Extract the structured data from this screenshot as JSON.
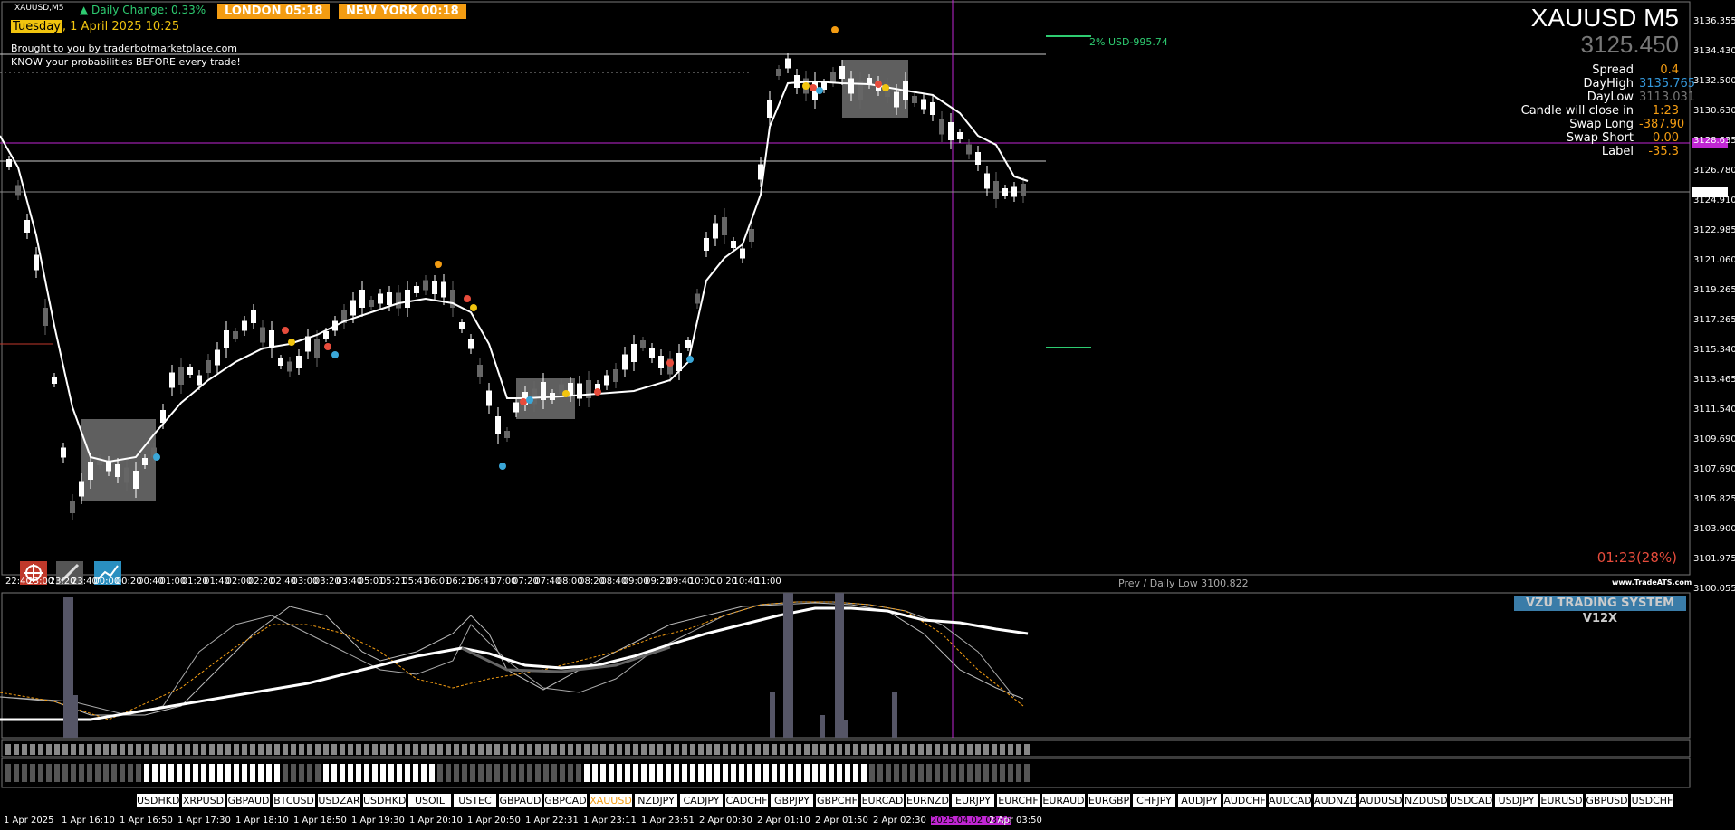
{
  "header": {
    "symbol_tf": "XAUUSD,M5",
    "daily_change": "▲ Daily Change: 0.33%",
    "sessions": [
      {
        "label": "LONDON  05:18"
      },
      {
        "label": "NEW YORK  00:18"
      }
    ],
    "date_day": "Tuesday",
    "date_rest": ", 1 April 2025 10:25",
    "promo1": "Brought to you by traderbotmarketplace.com",
    "promo2": "KNOW your probabilities BEFORE every trade!"
  },
  "panel": {
    "symbol": "XAUUSD M5",
    "price": "3125.450",
    "rows": [
      {
        "label": "Spread",
        "value": "0.4",
        "value_color": "#f39c12"
      },
      {
        "label": "DayHigh",
        "value": "3135.765",
        "value_color": "#3498db"
      },
      {
        "label": "DayLow",
        "value": "3113.031",
        "value_color": "#777777"
      },
      {
        "label": "Candle will close in",
        "value": "1:23",
        "value_color": "#f39c12"
      },
      {
        "label": "Swap Long",
        "value": "-387.90",
        "value_color": "#f39c12"
      },
      {
        "label": "Swap Short",
        "value": "0.00",
        "value_color": "#f39c12"
      },
      {
        "label": "Label",
        "value": "-35.3",
        "value_color": "#f39c12"
      }
    ]
  },
  "risk_label": "2% USD-995.74",
  "timer": "01:23(28%)",
  "prev_low": "Prev / Daily Low 3100.822",
  "brand": "www.TradeATS.com",
  "price_axis": [
    "3136.355",
    "3134.430",
    "3132.500",
    "3130.630",
    "3128.635",
    "3126.780",
    "3124.910",
    "3122.985",
    "3121.060",
    "3119.265",
    "3117.265",
    "3115.340",
    "3113.465",
    "3111.540",
    "3109.690",
    "3107.690",
    "3105.825",
    "3103.900",
    "3101.975",
    "3100.055"
  ],
  "current_price_tag": "3125.450",
  "magenta_tag": "3128.539",
  "time_axis": [
    "22:40",
    "23:00",
    "23:20",
    "23:40",
    "00:00",
    "00:20",
    "00:40",
    "01:00",
    "01:20",
    "01:40",
    "02:00",
    "02:20",
    "02:40",
    "03:00",
    "03:20",
    "03:40",
    "05:01",
    "05:21",
    "05:41",
    "06:01",
    "06:21",
    "06:41",
    "07:00",
    "07:20",
    "07:40",
    "08:00",
    "08:20",
    "08:40",
    "09:00",
    "09:20",
    "09:40",
    "10:00",
    "10:20",
    "10:40",
    "11:00"
  ],
  "indicator_title": "VZU TRADING SYSTEM V12X",
  "indicator_zero": "0",
  "tickers": [
    "USDHKD",
    "XRPUSD",
    "GBPAUD",
    "BTCUSD",
    "USDZAR",
    "USDHKD",
    "USOIL",
    "USTEC",
    "GBPAUD",
    "GBPCAD",
    "XAUUSD",
    "NZDJPY",
    "CADJPY",
    "CADCHF",
    "GBPJPY",
    "GBPCHF",
    "EURCAD",
    "EURNZD",
    "EURJPY",
    "EURCHF",
    "EURAUD",
    "EURGBP",
    "CHFJPY",
    "AUDJPY",
    "AUDCHF",
    "AUDCAD",
    "AUDNZD",
    "AUDUSD",
    "NZDUSD",
    "USDCAD",
    "USDJPY",
    "EURUSD",
    "GBPUSD",
    "USDCHF"
  ],
  "active_ticker": "XAUUSD",
  "bottom_times": [
    "1 Apr 2025",
    "1 Apr 16:10",
    "1 Apr 16:50",
    "1 Apr 17:30",
    "1 Apr 18:10",
    "1 Apr 18:50",
    "1 Apr 19:30",
    "1 Apr 20:10",
    "1 Apr 20:50",
    "1 Apr 22:31",
    "1 Apr 23:11",
    "1 Apr 23:51",
    "2 Apr 00:30",
    "2 Apr 01:10",
    "2 Apr 01:50",
    "2 Apr 02:30",
    "2025.04.02 03:05",
    "2 Apr 03:50"
  ],
  "colors": {
    "magenta": "#c026d3",
    "orange": "#f39c12",
    "green": "#2ecc71",
    "cyan": "#3aa7d8"
  },
  "icons": [
    "target-icon",
    "tools-icon",
    "chart-icon"
  ]
}
